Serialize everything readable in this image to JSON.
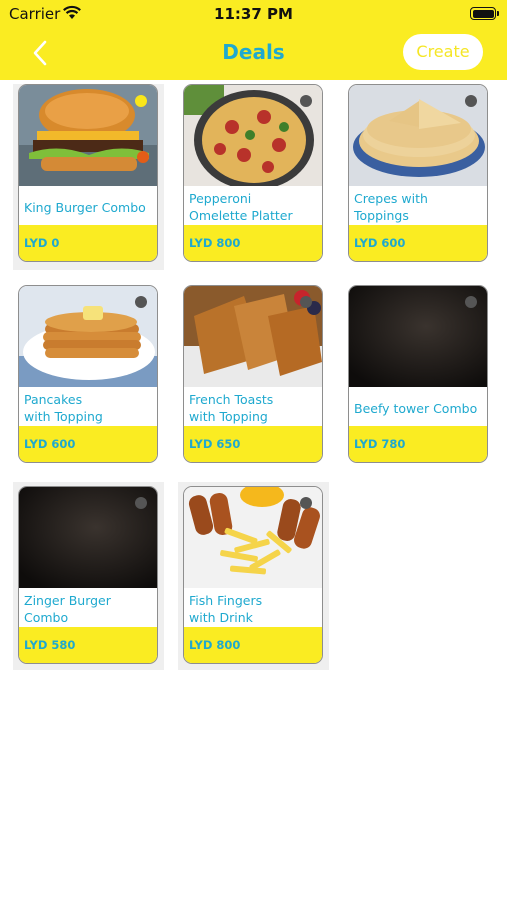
{
  "status_bar": {
    "carrier": "Carrier",
    "time": "11:37 PM"
  },
  "header": {
    "title": "Deals",
    "create_label": "Create"
  },
  "deals": [
    {
      "name": "King Burger Combo",
      "price": "LYD 0",
      "selected": true
    },
    {
      "name": "Pepperoni\nOmelette Platter",
      "price": "LYD 800",
      "selected": false
    },
    {
      "name": "Crepes with\nToppings",
      "price": "LYD 600",
      "selected": false
    },
    {
      "name": "Pancakes\nwith Topping",
      "price": "LYD 600",
      "selected": false
    },
    {
      "name": "French Toasts\nwith Topping",
      "price": "LYD 650",
      "selected": false
    },
    {
      "name": "Beefy tower Combo",
      "price": "LYD 780",
      "selected": false
    },
    {
      "name": "Zinger Burger\nCombo",
      "price": "LYD 580",
      "selected": false
    },
    {
      "name": "Fish Fingers\nwith Drink",
      "price": "LYD 800",
      "selected": false
    }
  ],
  "colors": {
    "accent": "#FAEC22",
    "text": "#1FA9CF"
  }
}
